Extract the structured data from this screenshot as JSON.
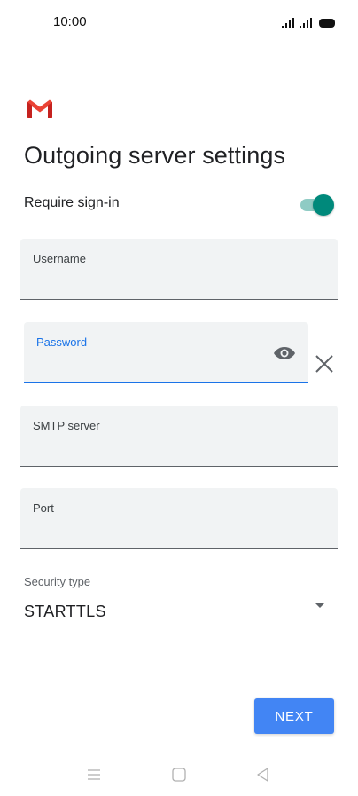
{
  "status_bar": {
    "time": "10:00"
  },
  "brand": {
    "logo_icon": "gmail-icon",
    "logo_colors": [
      "#ea4335",
      "#c5221f"
    ]
  },
  "page": {
    "title": "Outgoing server settings"
  },
  "require_signin": {
    "label": "Require sign-in",
    "enabled": true,
    "color": "#00897b"
  },
  "fields": {
    "username": {
      "label": "Username",
      "value": ""
    },
    "password": {
      "label": "Password",
      "value": "",
      "focused": true
    },
    "smtp_server": {
      "label": "SMTP server",
      "value": ""
    },
    "port": {
      "label": "Port",
      "value": ""
    }
  },
  "security": {
    "label": "Security type",
    "selected": "STARTTLS"
  },
  "actions": {
    "next_label": "NEXT",
    "accent_color": "#4285f4"
  },
  "navigation": {
    "icons": [
      "menu-icon",
      "home-square-icon",
      "back-triangle-icon"
    ]
  }
}
